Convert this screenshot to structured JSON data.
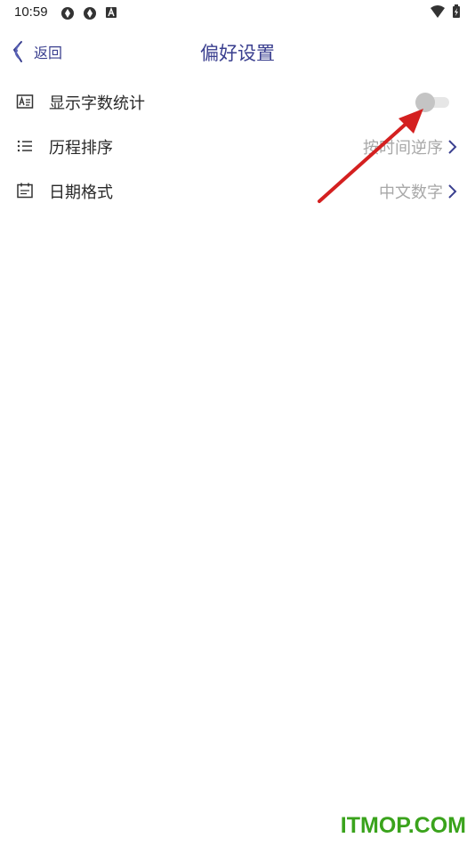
{
  "status_bar": {
    "time": "10:59",
    "icons": [
      "sync-icon",
      "sync-icon",
      "a-notification-icon",
      "wifi-icon",
      "battery-icon"
    ]
  },
  "header": {
    "back_label": "返回",
    "title": "偏好设置"
  },
  "settings": [
    {
      "label": "显示字数统计",
      "icon": "word-count-icon",
      "control": "toggle",
      "toggle_on": false
    },
    {
      "label": "历程排序",
      "icon": "list-icon",
      "value": "按时间逆序"
    },
    {
      "label": "日期格式",
      "icon": "calendar-icon",
      "value": "中文数字"
    }
  ],
  "colors": {
    "accent": "#3a3f8f",
    "value_text": "#a8a8a8",
    "annotation_arrow": "#d42020",
    "watermark": "#3aa31c"
  },
  "watermark": "ITMOP.COM"
}
